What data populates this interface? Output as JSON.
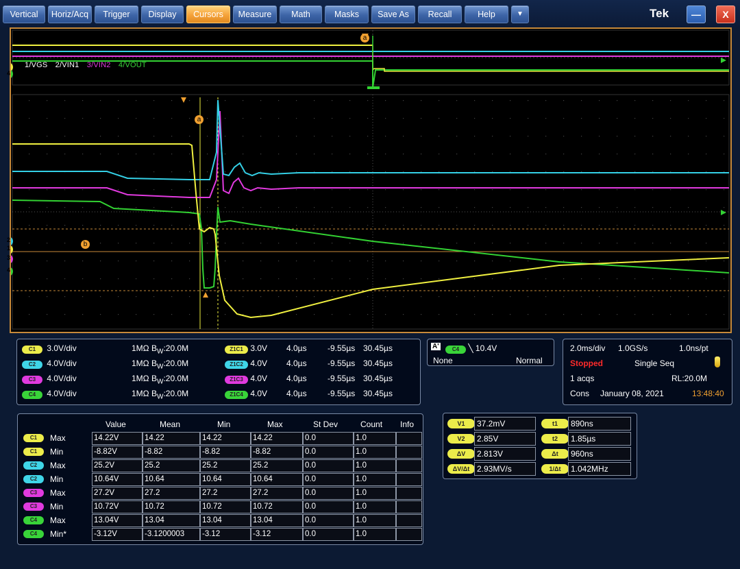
{
  "menu": {
    "items": [
      "Vertical",
      "Horiz/Acq",
      "Trigger",
      "Display",
      "Cursors",
      "Measure",
      "Math",
      "Masks",
      "Save As",
      "Recall",
      "Help",
      "▼"
    ],
    "active_index": 4,
    "brand": "Tek",
    "minimize": "—",
    "close": "X"
  },
  "scope": {
    "trace_labels": [
      {
        "text": "1/VGS",
        "color": "#ffffff"
      },
      {
        "text": "2/VIN1",
        "color": "#ffffff"
      },
      {
        "text": "3/VIN2",
        "color": "#e03adf"
      },
      {
        "text": "4/VOUT",
        "color": "#39d439"
      }
    ],
    "cursor_a": "a",
    "cursor_b": "b",
    "channel_markers": [
      "1",
      "2",
      "3",
      "4"
    ],
    "colors": {
      "ch1": "#f0f040",
      "ch2": "#34d0e6",
      "ch3": "#e23ae0",
      "ch4": "#33d233",
      "cursor": "#f0a030"
    }
  },
  "channels": [
    {
      "tag": "C1",
      "scale": "3.0V/div",
      "coupling": "1MΩ",
      "bw_prefix": "B",
      "bw_sub": "W",
      "bw_value": ":20.0M",
      "zoom_tag": "Z1C1",
      "zoom_scale": "3.0V",
      "zoom_time": "4.0µs",
      "zoom_start": "-9.55µs",
      "zoom_end": "30.45µs"
    },
    {
      "tag": "C2",
      "scale": "4.0V/div",
      "coupling": "1MΩ",
      "bw_prefix": "B",
      "bw_sub": "W",
      "bw_value": ":20.0M",
      "zoom_tag": "Z1C2",
      "zoom_scale": "4.0V",
      "zoom_time": "4.0µs",
      "zoom_start": "-9.55µs",
      "zoom_end": "30.45µs"
    },
    {
      "tag": "C3",
      "scale": "4.0V/div",
      "coupling": "1MΩ",
      "bw_prefix": "B",
      "bw_sub": "W",
      "bw_value": ":20.0M",
      "zoom_tag": "Z1C3",
      "zoom_scale": "4.0V",
      "zoom_time": "4.0µs",
      "zoom_start": "-9.55µs",
      "zoom_end": "30.45µs"
    },
    {
      "tag": "C4",
      "scale": "4.0V/div",
      "coupling": "1MΩ",
      "bw_prefix": "B",
      "bw_sub": "W",
      "bw_value": ":20.0M",
      "zoom_tag": "Z1C4",
      "zoom_scale": "4.0V",
      "zoom_time": "4.0µs",
      "zoom_start": "-9.55µs",
      "zoom_end": "30.45µs"
    }
  ],
  "trigger": {
    "tag_a": "A'",
    "source": "C4",
    "slope": "╲",
    "level": "10.4V",
    "mode_left": "None",
    "mode_right": "Normal"
  },
  "acquisition": {
    "time_div": "2.0ms/div",
    "sample_rate": "1.0GS/s",
    "resolution": "1.0ns/pt",
    "state": "Stopped",
    "mode": "Single Seq",
    "acqs": "1 acqs",
    "record_length": "RL:20.0M",
    "cons": "Cons",
    "date": "January 08, 2021",
    "time": "13:48:40"
  },
  "measurements": {
    "headers": [
      "Value",
      "Mean",
      "Min",
      "Max",
      "St Dev",
      "Count",
      "Info"
    ],
    "rows": [
      {
        "tag": "C1",
        "stat": "Max",
        "value": "14.22V",
        "mean": "14.22",
        "min": "14.22",
        "max": "14.22",
        "stdev": "0.0",
        "count": "1.0",
        "info": ""
      },
      {
        "tag": "C1",
        "stat": "Min",
        "value": "-8.82V",
        "mean": "-8.82",
        "min": "-8.82",
        "max": "-8.82",
        "stdev": "0.0",
        "count": "1.0",
        "info": ""
      },
      {
        "tag": "C2",
        "stat": "Max",
        "value": "25.2V",
        "mean": "25.2",
        "min": "25.2",
        "max": "25.2",
        "stdev": "0.0",
        "count": "1.0",
        "info": ""
      },
      {
        "tag": "C2",
        "stat": "Min",
        "value": "10.64V",
        "mean": "10.64",
        "min": "10.64",
        "max": "10.64",
        "stdev": "0.0",
        "count": "1.0",
        "info": ""
      },
      {
        "tag": "C3",
        "stat": "Max",
        "value": "27.2V",
        "mean": "27.2",
        "min": "27.2",
        "max": "27.2",
        "stdev": "0.0",
        "count": "1.0",
        "info": ""
      },
      {
        "tag": "C3",
        "stat": "Min",
        "value": "10.72V",
        "mean": "10.72",
        "min": "10.72",
        "max": "10.72",
        "stdev": "0.0",
        "count": "1.0",
        "info": ""
      },
      {
        "tag": "C4",
        "stat": "Max",
        "value": "13.04V",
        "mean": "13.04",
        "min": "13.04",
        "max": "13.04",
        "stdev": "0.0",
        "count": "1.0",
        "info": ""
      },
      {
        "tag": "C4",
        "stat": "Min*",
        "value": "-3.12V",
        "mean": "-3.1200003",
        "min": "-3.12",
        "max": "-3.12",
        "stdev": "0.0",
        "count": "1.0",
        "info": ""
      }
    ]
  },
  "cursor_readout": {
    "v1_label": "V1",
    "v1": "37.2mV",
    "v2_label": "V2",
    "v2": "2.85V",
    "dv_label": "ΔV",
    "dv": "2.813V",
    "dvdt_label": "ΔV/Δt",
    "dvdt": "2.93MV/s",
    "t1_label": "t1",
    "t1": "890ns",
    "t2_label": "t2",
    "t2": "1.85µs",
    "dt_label": "Δt",
    "dt": "960ns",
    "inv_dt_label": "1/Δt",
    "inv_dt": "1.042MHz"
  }
}
